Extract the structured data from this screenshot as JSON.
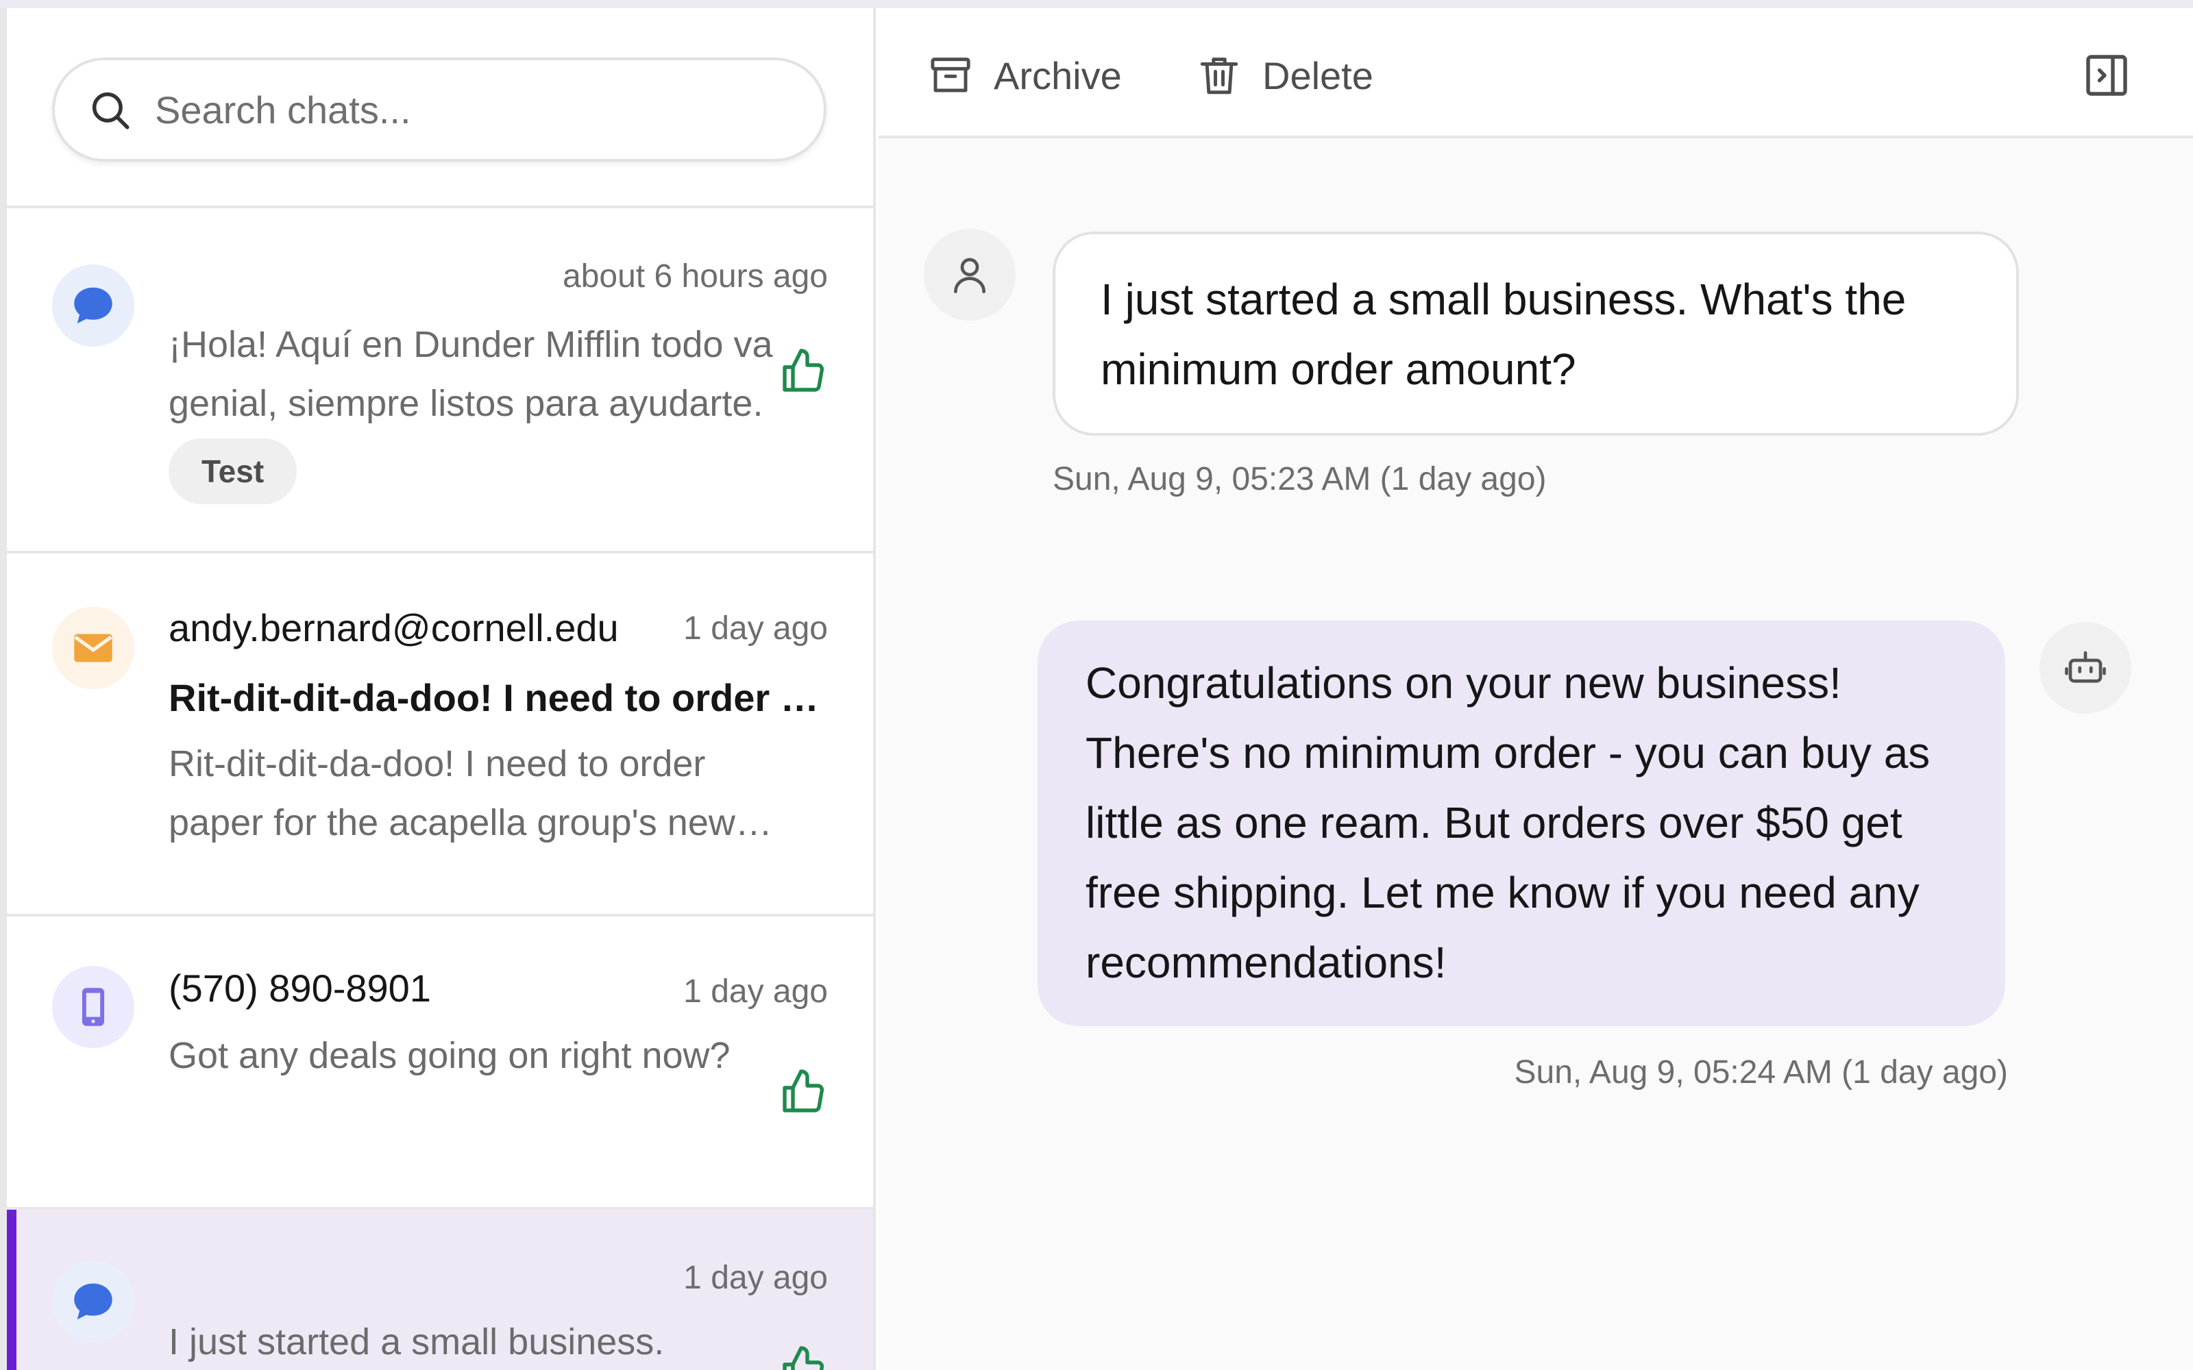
{
  "search": {
    "placeholder": "Search chats..."
  },
  "chats": [
    {
      "channel": "chat-bubble",
      "time": "about 6 hours ago",
      "preview": "¡Hola! Aquí en Dunder Mifflin todo va genial, siempre listos para ayudarte.",
      "tag": "Test",
      "rated": "thumbs-up"
    },
    {
      "channel": "email",
      "sender": "andy.bernard@cornell.edu",
      "time": "1 day ago",
      "subject": "Rit-dit-dit-da-doo! I need to order paper",
      "preview": "Rit-dit-dit-da-doo! I need to order paper for the acapella group's new songbooks."
    },
    {
      "channel": "sms",
      "sender": "(570) 890-8901",
      "time": "1 day ago",
      "preview": "Got any deals going on right now?",
      "rated": "thumbs-up"
    },
    {
      "channel": "chat-bubble",
      "time": "1 day ago",
      "preview": "I just started a small business.",
      "rated": "thumbs-up",
      "selected": true
    }
  ],
  "toolbar": {
    "archive_label": "Archive",
    "delete_label": "Delete"
  },
  "conversation": [
    {
      "role": "user",
      "text": "I just started a small business. What's the minimum order amount?",
      "timestamp": "Sun, Aug 9, 05:23 AM (1 day ago)"
    },
    {
      "role": "assistant",
      "text": "Congratulations on your new business! There's no minimum order - you can buy as little as one ream. But orders over $50 get free shipping. Let me know if you need any recommendations!",
      "timestamp": "Sun, Aug 9, 05:24 AM (1 day ago)"
    }
  ],
  "colors": {
    "accent": "#6b1fd6",
    "selected_bg": "#efe9f6",
    "assistant_bubble": "#ece6f6",
    "chat_icon": "#3b6fe0",
    "email_icon": "#f0a43a",
    "sms_icon": "#7b70e8",
    "thumbs_up": "#1e8a4c"
  },
  "icons": {
    "search": "search-icon",
    "archive": "archive-icon",
    "delete": "trash-icon",
    "panel": "panel-toggle-icon",
    "user": "user-icon",
    "bot": "bot-icon"
  }
}
